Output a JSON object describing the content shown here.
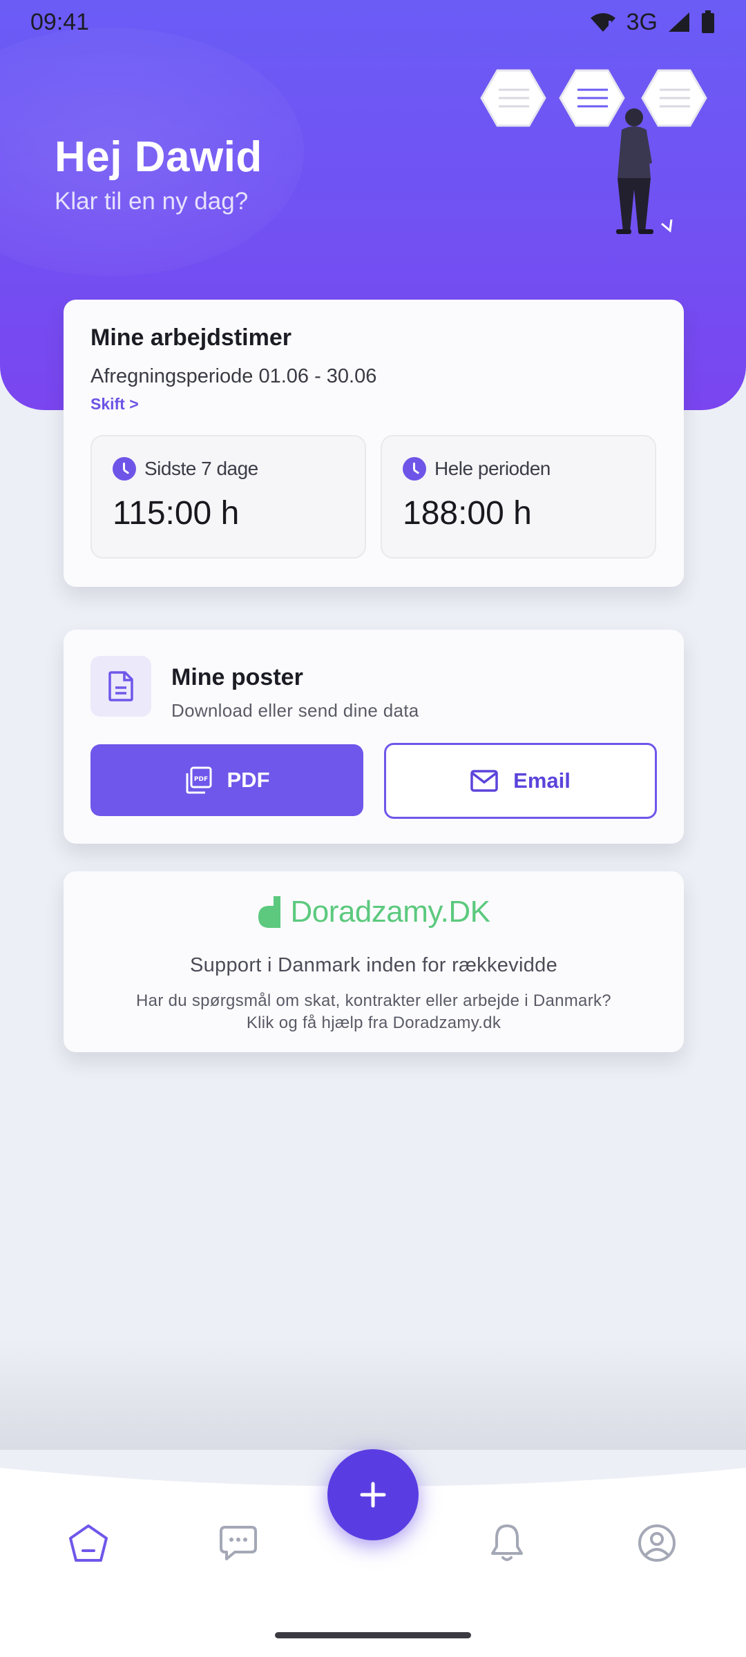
{
  "status_bar": {
    "time": "09:41",
    "network": "3G"
  },
  "header": {
    "greeting": "Hej Dawid",
    "subtitle": "Klar til en ny dag?"
  },
  "hours_card": {
    "title": "Mine arbejdstimer",
    "period": "Afregningsperiode 01.06 - 30.06",
    "switch_link": "Skift >",
    "stats": [
      {
        "label": "Sidste 7 dage",
        "value": "115:00 h"
      },
      {
        "label": "Hele perioden",
        "value": "188:00 h"
      }
    ]
  },
  "posts_card": {
    "title": "Mine poster",
    "subtitle": "Download eller send dine data",
    "pdf_button": "PDF",
    "email_button": "Email"
  },
  "support_card": {
    "brand": "Doradzamy.DK",
    "heading": "Support i Danmark inden for rækkevidde",
    "body_line1": "Har du spørgsmål om skat, kontrakter eller arbejde i Danmark?",
    "body_line2": "Klik og få hjælp fra Doradzamy.dk"
  },
  "bottom_nav": {
    "items": [
      "home-icon",
      "chat-icon",
      "add-icon",
      "bell-icon",
      "profile-icon"
    ],
    "active": "home-icon"
  },
  "colors": {
    "accent": "#6e57ea",
    "header_gradient_top": "#6b5cf6",
    "brand_green": "#5cc97e",
    "background": "#eceff5"
  }
}
